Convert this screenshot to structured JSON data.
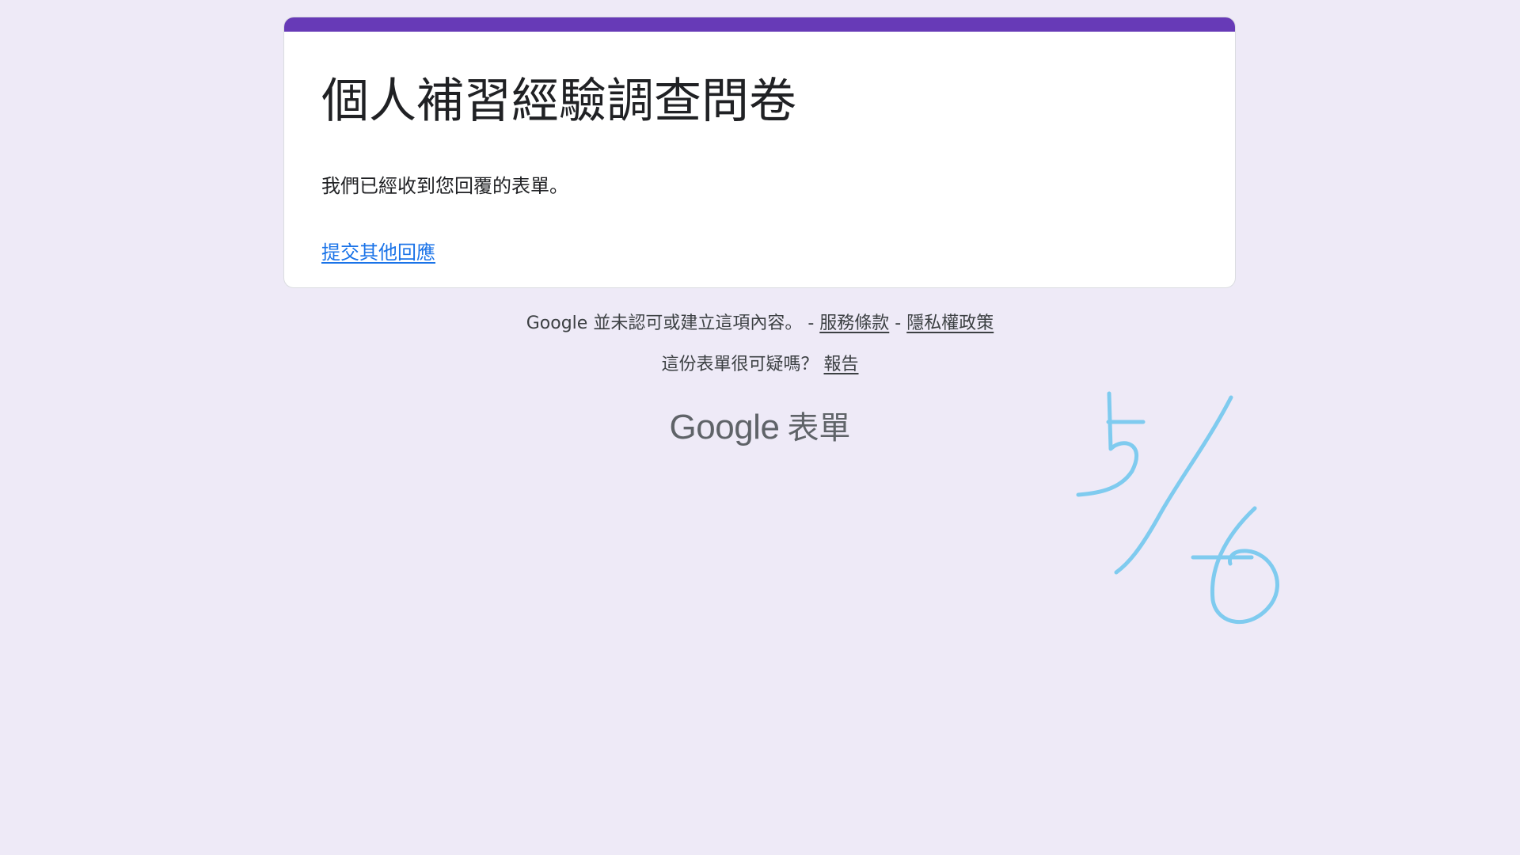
{
  "form": {
    "title": "個人補習經驗調查問卷",
    "confirmation_message": "我們已經收到您回覆的表單。",
    "submit_another_label": "提交其他回應",
    "accent_color": "#673AB7"
  },
  "footer": {
    "disclaimer_text": "Google 並未認可或建立這項內容。 -",
    "separator": "-",
    "terms_label": "服務條款",
    "privacy_label": "隱私權政策",
    "report_question": "這份表單很可疑嗎？",
    "report_label": "報告",
    "logo_google": "Google",
    "logo_product": "表單"
  },
  "annotation": {
    "handwritten_note": "5/6",
    "color": "#7FCBEF"
  },
  "colors": {
    "background": "#EEEAF7",
    "link": "#1a73e8"
  }
}
